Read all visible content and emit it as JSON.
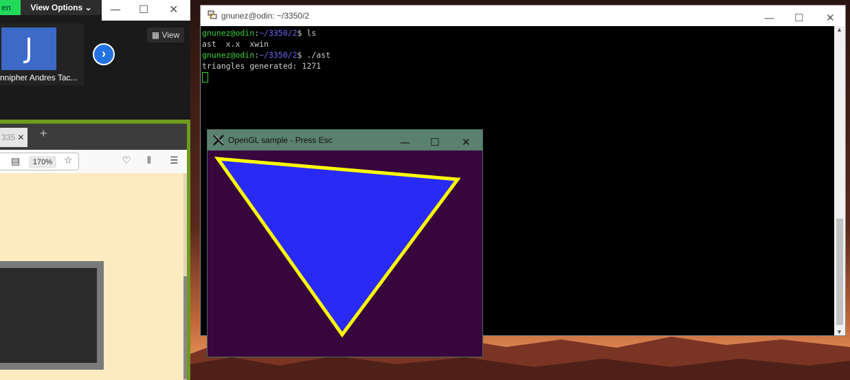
{
  "zoom": {
    "green_label": "en",
    "view_options": "View Options",
    "participant_initial": "J",
    "participant_name": "nnipher Andres Tac...",
    "view_button": "View"
  },
  "browser": {
    "tab_label": "335",
    "zoom_level": "170%"
  },
  "terminal": {
    "title": "gnunez@odin: ~/3350/2",
    "lines": [
      {
        "user": "gnunez@odin",
        "path": "~/3350/2",
        "cmd": "ls"
      },
      {
        "output": "ast  x.x  xwin"
      },
      {
        "user": "gnunez@odin",
        "path": "~/3350/2",
        "cmd": "./ast"
      },
      {
        "output": "triangles generated: 1271"
      }
    ]
  },
  "opengl": {
    "title": "OpenGL sample  -  Press Esc",
    "colors": {
      "background": "#38063d",
      "fill": "#2a2af5",
      "outline": "#ffff00"
    }
  }
}
